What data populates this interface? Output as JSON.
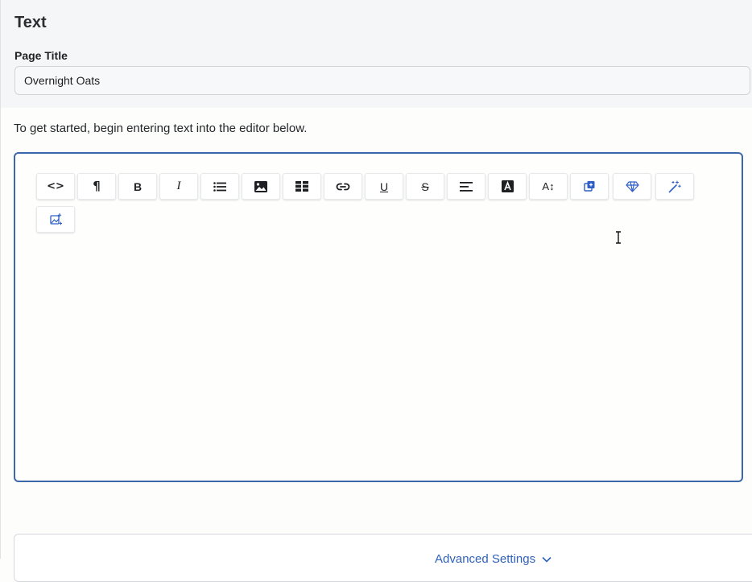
{
  "header": {
    "title": "Text",
    "page_title_label": "Page Title",
    "page_title_value": "Overnight Oats"
  },
  "intro_text": "To get started, begin entering text into the editor below.",
  "toolbar": {
    "code": "<>",
    "paragraph": "¶",
    "bold": "B",
    "italic": "I",
    "underline": "U",
    "strikethrough": "S",
    "font_size": "A↕"
  },
  "advanced": {
    "label": "Advanced Settings"
  },
  "colors": {
    "accent": "#3c67a8",
    "ai_icon": "#2f5fc4",
    "link": "#2f61b9"
  }
}
